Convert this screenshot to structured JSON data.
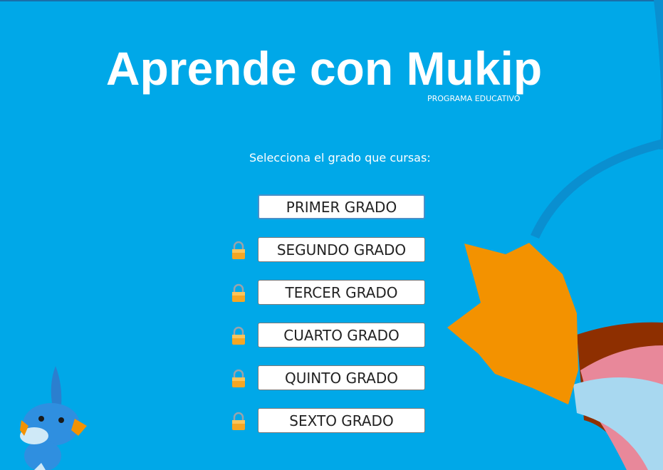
{
  "header": {
    "title": "Aprende con Mukip",
    "subtitle": "PROGRAMA EDUCATIVO"
  },
  "prompt": "Selecciona el grado que cursas:",
  "grades": [
    {
      "label": "PRIMER GRADO",
      "locked": false
    },
    {
      "label": "SEGUNDO GRADO",
      "locked": true
    },
    {
      "label": "TERCER GRADO",
      "locked": true
    },
    {
      "label": "CUARTO GRADO",
      "locked": true
    },
    {
      "label": "QUINTO GRADO",
      "locked": true
    },
    {
      "label": "SEXTO GRADO",
      "locked": true
    }
  ],
  "icons": {
    "lock": "lock-icon",
    "mascot": "mudkip-mascot"
  },
  "colors": {
    "background": "#00a8e8",
    "title": "#ffffff",
    "fin": "#f39200",
    "lock_body": "#f5a623"
  }
}
